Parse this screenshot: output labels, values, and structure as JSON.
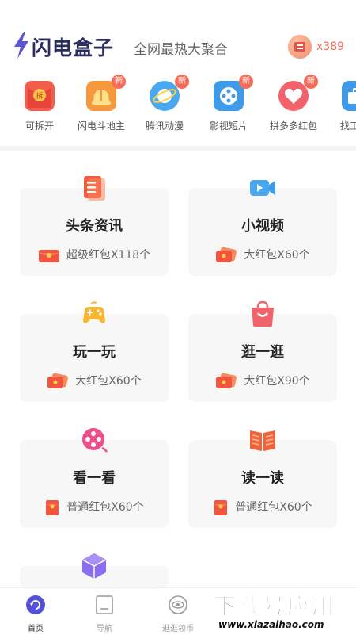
{
  "header": {
    "logo_text": "闪电盒子",
    "slogan": "全网最热大聚合",
    "coin_count": "x389"
  },
  "shortcuts": [
    {
      "label": "可拆开",
      "icon": "red-envelope-icon",
      "color": "#f25e4e",
      "badge": ""
    },
    {
      "label": "闪电斗地主",
      "icon": "landlord-hat-icon",
      "color": "#f59a3c",
      "badge": "新"
    },
    {
      "label": "腾讯动漫",
      "icon": "planet-icon",
      "color": "#49a8ef",
      "badge": "新"
    },
    {
      "label": "影视短片",
      "icon": "film-reel-icon",
      "color": "#3d9bea",
      "badge": "新"
    },
    {
      "label": "拼多多红包",
      "icon": "pdd-heart-icon",
      "color": "#f1626a",
      "badge": "新"
    },
    {
      "label": "找工",
      "icon": "briefcase-icon",
      "color": "#3d9bea",
      "badge": ""
    }
  ],
  "cards": [
    {
      "title": "头条资讯",
      "subtitle": "超级红包X118个",
      "icon": "news-doc-icon"
    },
    {
      "title": "小视频",
      "subtitle": "大红包X60个",
      "icon": "video-camera-icon"
    },
    {
      "title": "玩一玩",
      "subtitle": "大红包X60个",
      "icon": "gamepad-icon"
    },
    {
      "title": "逛一逛",
      "subtitle": "大红包X90个",
      "icon": "shopping-bag-icon"
    },
    {
      "title": "看一看",
      "subtitle": "普通红包X60个",
      "icon": "film-reel-icon"
    },
    {
      "title": "读一读",
      "subtitle": "普通红包X60个",
      "icon": "open-book-icon"
    },
    {
      "title": "",
      "subtitle": "",
      "icon": "cube-icon"
    }
  ],
  "tabs": [
    {
      "label": "首页",
      "icon": "home-refresh-icon",
      "active": true
    },
    {
      "label": "导航",
      "icon": "navigation-icon",
      "active": false
    },
    {
      "label": "逛逛领币",
      "icon": "eye-icon",
      "active": false
    }
  ],
  "watermark": {
    "main": "下载号应用",
    "url": "www.xiazaihao.com"
  },
  "colors": {
    "brand": "#2b2d5e",
    "accent": "#f26a5a",
    "card_bg": "#f7f7f7"
  }
}
